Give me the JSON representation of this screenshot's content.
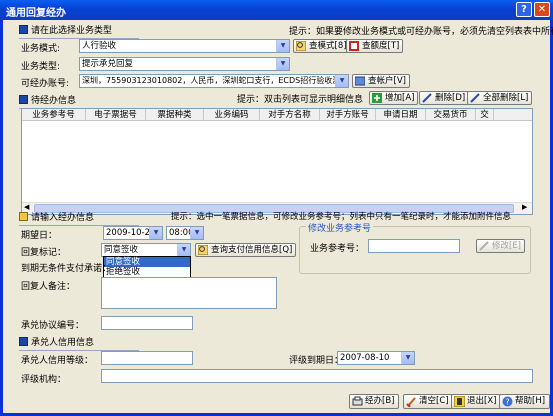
{
  "window": {
    "title": "通用回复经办",
    "help_btn": "?",
    "close_btn": "✕"
  },
  "top_section": {
    "title": "请在此选择业务类型",
    "hint": "提示：如果要修改业务模式或可经办账号，必须先清空列表表中所有记录"
  },
  "form": {
    "mode_label": "业务模式:",
    "mode_value": "人行验收",
    "type_label": "业务类型:",
    "type_value": "提示承兑回复",
    "account_label": "可经办账号:",
    "account_value": "深圳，755903123010802，人民币，深圳蛇口支行，ECDS招行验收测试一",
    "query_mode_btn": "查模式[8]",
    "query_amount_btn": "查额度[T]",
    "query_account_btn": "查帐户[V]"
  },
  "pending": {
    "title": "待经办信息",
    "hint": "提示：双击列表可显示明细信息",
    "add_btn": "增加[A]",
    "delete_btn": "删除[D]",
    "delete_all_btn": "全部删除[L]",
    "columns": [
      "业务参考号",
      "电子票据号",
      "票据种类",
      "业务编码",
      "对手方名称",
      "对手方账号",
      "申请日期",
      "交易货币",
      "交"
    ]
  },
  "input": {
    "title": "请输入经办信息",
    "hint": "提示：选中一笔票据信息，可修改业务参考号；列表中只有一笔纪录时，才能添加附件信息",
    "date_label": "期望日：",
    "date_value": "2009-10-20",
    "time_value": "08:00",
    "reply_label": "回复标记：",
    "reply_value": "同意签收",
    "query_credit_btn": "查询支付信用信息[Q]",
    "reply_options": [
      "同意签收",
      "拒绝签收"
    ],
    "promise_label": "到期无条件支付承诺：",
    "remark_label": "回复人备注：",
    "modify_title": "修改业务参考号",
    "ref_label": "业务参考号：",
    "modify_btn": "修改[E]",
    "agreement_label": "承兑协议编号："
  },
  "credit": {
    "title": "承兑人信用信息",
    "grade_label": "承兑人信用等级：",
    "expire_label": "评级到期日：",
    "expire_value": "2007-08-10",
    "agency_label": "评级机构："
  },
  "buttons": {
    "handle": "经办[B]",
    "clear": "清空[C]",
    "exit": "退出[X]",
    "help": "帮助[H]"
  },
  "colors": {
    "titlebar": "#0a5fef",
    "face": "#ece9d8",
    "accent": "#316ac5"
  }
}
